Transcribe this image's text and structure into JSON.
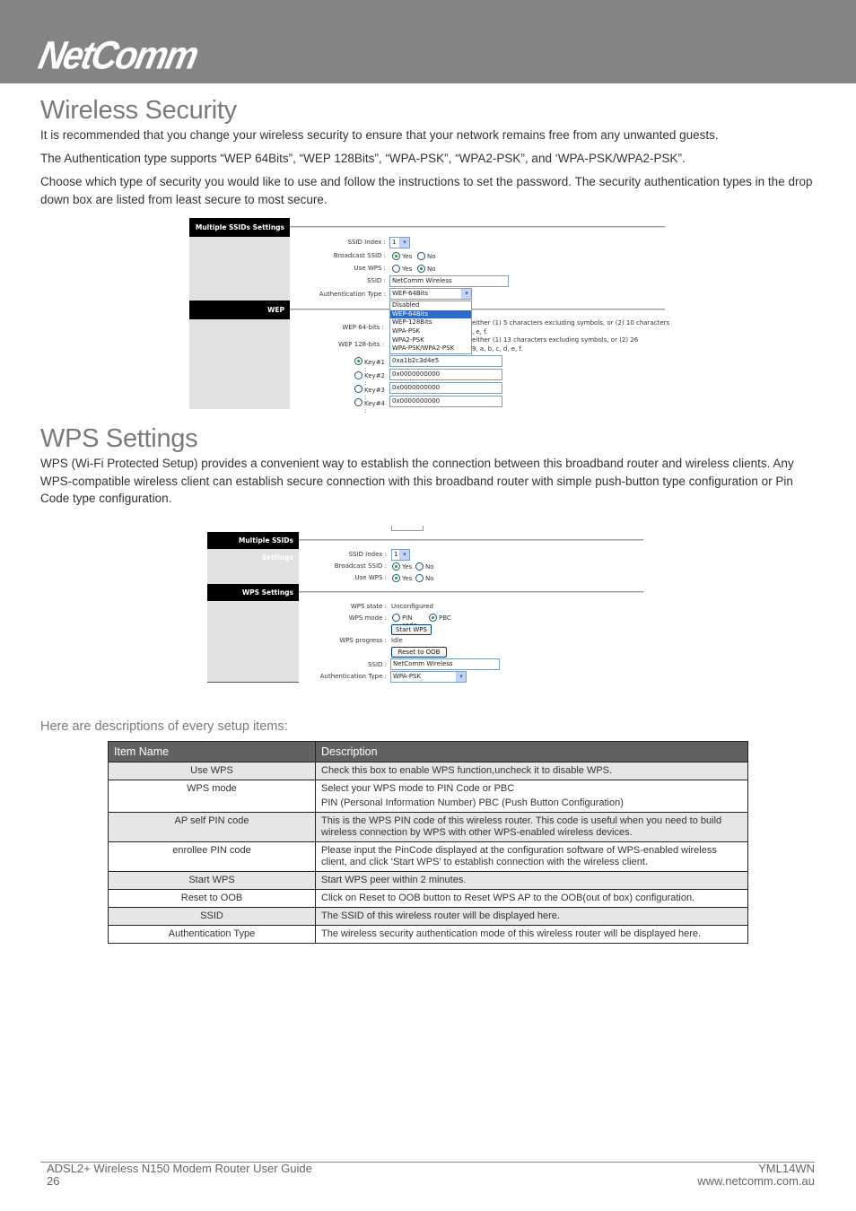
{
  "header": {
    "logo": "NetComm"
  },
  "wireless_security": {
    "title": "Wireless Security",
    "paragraphs": [
      "It is recommended that you change your wireless security to ensure that your network remains free from any unwanted guests.",
      "The Authentication type supports “WEP 64Bits”, “WEP 128Bits”, “WPA-PSK”, “WPA2-PSK”, and ‘WPA-PSK/WPA2-PSK”.",
      "Choose which type of security you would like to use and follow the instructions to set the password. The security authentication types in the drop down box are listed from least secure to most secure."
    ],
    "screenshot": {
      "section1_title": "Multiple SSIDs Settings",
      "ssid_index_label": "SSID Index :",
      "ssid_index_value": "1",
      "broadcast_ssid_label": "Broadcast SSID :",
      "broadcast_yes": "Yes",
      "broadcast_no": "No",
      "broadcast_selected": "Yes",
      "use_wps_label": "Use WPS :",
      "use_wps_yes": "Yes",
      "use_wps_no": "No",
      "use_wps_selected": "No",
      "ssid_label": "SSID :",
      "ssid_value": "NetComm Wireless",
      "auth_label": "Authentication Type :",
      "auth_value": "WEP-64Bits",
      "auth_options": [
        "Disabled",
        "WEP-64Bits",
        "WEP-128Bits",
        "WPA-PSK",
        "WPA2-PSK",
        "WPA-PSK/WPA2-PSK"
      ],
      "auth_highlighted": "WEP-64Bits",
      "section2_title": "WEP",
      "wep64_label": "WEP 64-bits :",
      "wep64_hint_1": "either (1) 5 characters excluding symbols, or (2) 10 characters",
      "wep64_hint_2": ", e, f.",
      "wep128_label": "WEP 128-bits :",
      "wep128_hint_1": "either (1) 13 characters excluding symbols, or (2) 26",
      "wep128_hint_2": "9, a, b, c, d, e, f.",
      "keys": [
        {
          "label": "Key#1 :",
          "value": "0xa1b2c3d4e5",
          "selected": true
        },
        {
          "label": "Key#2 :",
          "value": "0x0000000000",
          "selected": false
        },
        {
          "label": "Key#3 :",
          "value": "0x0000000000",
          "selected": false
        },
        {
          "label": "Key#4 :",
          "value": "0x0000000000",
          "selected": false
        }
      ]
    }
  },
  "wps_settings": {
    "title": "WPS Settings",
    "paragraph": "WPS (Wi-Fi Protected Setup) provides a convenient way to establish the connection between this broadband router and wireless clients. Any WPS-compatible wireless client can establish secure connection with this broadband router with simple push-button type configuration or Pin Code type configuration.",
    "screenshot": {
      "section1_title": "Multiple SSIDs Settings",
      "ssid_index_label": "SSID Index :",
      "ssid_index_value": "1",
      "broadcast_ssid_label": "Broadcast SSID :",
      "broadcast_yes": "Yes",
      "broadcast_no": "No",
      "broadcast_selected": "Yes",
      "use_wps_label": "Use WPS :",
      "use_wps_yes": "Yes",
      "use_wps_no": "No",
      "use_wps_selected": "Yes",
      "section2_title": "WPS Settings",
      "wps_state_label": "WPS state :",
      "wps_state_value": "Unconfigured",
      "wps_mode_label": "WPS mode :",
      "wps_mode_pin": "PIN code",
      "wps_mode_pbc": "PBC",
      "wps_mode_selected": "PBC",
      "start_wps_button": "Start WPS",
      "wps_progress_label": "WPS progress :",
      "wps_progress_value": "Idle",
      "reset_oob_button": "Reset to OOB",
      "ssid_label": "SSID :",
      "ssid_value": "NetComm Wireless",
      "auth_label": "Authentication Type :",
      "auth_value": "WPA-PSK"
    }
  },
  "descriptions": {
    "heading": "Here are descriptions of every setup items:",
    "columns": [
      "Item Name",
      "Description"
    ],
    "rows": [
      {
        "name": "Use WPS",
        "desc": "Check this box to enable WPS function,uncheck it to disable WPS."
      },
      {
        "name": "WPS mode",
        "desc": "Select your WPS mode to PIN Code or PBC",
        "desc2": "PIN (Personal Information Number) PBC (Push Button Configuration)"
      },
      {
        "name": "AP self PIN code",
        "desc": "This is the WPS PIN code of this wireless router. This code is useful when you need to build wireless connection by WPS with other WPS-enabled wireless devices."
      },
      {
        "name": "enrollee PIN code",
        "desc": "Please input the PinCode displayed at the configuration software of WPS-enabled wireless client, and click ‘Start WPS’ to establish connection with the wireless client."
      },
      {
        "name": "Start WPS",
        "desc": "Start WPS peer within 2 minutes."
      },
      {
        "name": "Reset to OOB",
        "desc": "Click on Reset to OOB button to Reset WPS AP to the OOB(out of box) configuration."
      },
      {
        "name": "SSID",
        "desc": "The SSID of this wireless router will be displayed here."
      },
      {
        "name": "Authentication Type",
        "desc": "The wireless security authentication mode of this wireless router will be displayed here."
      }
    ]
  },
  "footer": {
    "guide_title": "ADSL2+ Wireless N150 Modem Router User Guide",
    "page_number": "26",
    "model": "YML14WN",
    "website": "www.netcomm.com.au"
  }
}
